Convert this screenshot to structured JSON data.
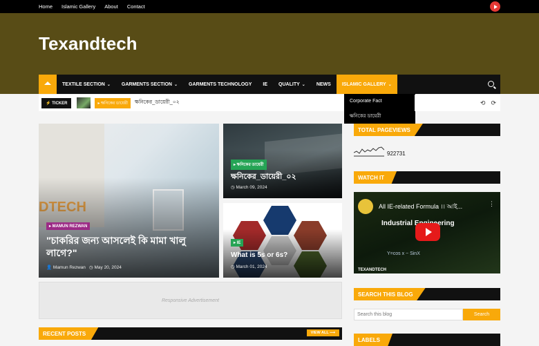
{
  "topbar": {
    "links": [
      "Home",
      "Islamic Gallery",
      "About",
      "Contact"
    ]
  },
  "site": {
    "title": "Texandtech"
  },
  "nav": {
    "home_icon": "home-icon",
    "items": [
      {
        "label": "TEXTILE SECTION",
        "caret": "⌄"
      },
      {
        "label": "GARMENTS SECTION",
        "caret": "⌄"
      },
      {
        "label": "GARMENTS TECHNOLOGY",
        "caret": ""
      },
      {
        "label": "IE",
        "caret": ""
      },
      {
        "label": "QUALITY",
        "caret": "⌄"
      },
      {
        "label": "NEWS",
        "caret": ""
      },
      {
        "label": "ISLAMIC GALLERY",
        "caret": "⌄"
      }
    ],
    "dropdown": [
      "Corporate Fact",
      "ক্ষনিকের ডায়েরী"
    ]
  },
  "ticker": {
    "label": "⚡ TICKER",
    "tag": "▸ ক্ষনিকের ডায়েরী",
    "text": "ক্ষনিকের_ডায়েরী_০২",
    "prev": "⟲",
    "next": "⟳"
  },
  "featured": [
    {
      "tag": "▸ MAMUN REZWAN",
      "title": "\"চাকরির জন্য আসলেই কি মামা খালু লাগে?\"",
      "author": "👤 Mamun Rezwan",
      "date": "◷ May 20, 2024"
    },
    {
      "tag": "▸ ক্ষনিকের ডায়েরী",
      "title": "ক্ষনিকের_ডায়েরী_০২",
      "date": "◷ March 09, 2024"
    },
    {
      "tag": "▸ IE",
      "title": "What is 5s or 6s?",
      "date": "◷ March 01, 2024"
    }
  ],
  "ad": {
    "text": "Responsive Advertisement"
  },
  "recent": {
    "title": "RECENT POSTS",
    "view_all": "VIEW ALL ⟶"
  },
  "sidebar": {
    "pageviews_title": "TOTAL PAGEVIEWS",
    "pageviews_count": "922731",
    "watch_title": "WATCH IT",
    "video_title": "All IE-related Formula ।। আই...",
    "video_heading": "Industrial Engineering",
    "video_footer": "TEXANDTECH",
    "search_title": "SEARCH THIS BLOG",
    "search_placeholder": "Search this blog",
    "search_button": "Search",
    "labels_title": "LABELS"
  },
  "colors": {
    "accent": "#f9a90a",
    "header": "#584c16",
    "nav": "#111111"
  }
}
